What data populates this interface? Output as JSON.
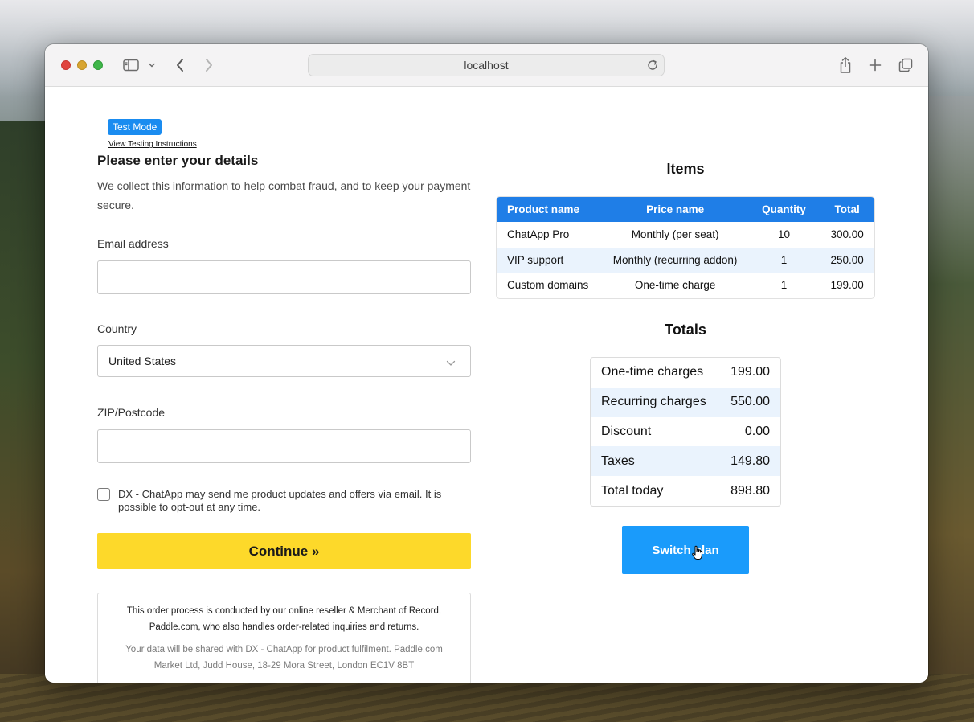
{
  "browser": {
    "address": "localhost"
  },
  "test_mode": {
    "badge": "Test Mode",
    "link": "View Testing Instructions"
  },
  "details": {
    "heading": "Please enter your details",
    "description": "We collect this information to help combat fraud, and to keep your payment secure.",
    "email_label": "Email address",
    "email_value": "",
    "country_label": "Country",
    "country_value": "United States",
    "zip_label": "ZIP/Postcode",
    "zip_value": "",
    "checkbox_label": "DX - ChatApp may send me product updates and offers via email. It is possible to opt-out at any time.",
    "checkbox_checked": false,
    "continue_label": "Continue »",
    "notice_primary": "This order process is conducted by our online reseller & Merchant of Record, Paddle.com, who also handles order-related inquiries and returns.",
    "notice_secondary": "Your data will be shared with DX - ChatApp for product fulfilment. Paddle.com Market Ltd, Judd House, 18-29 Mora Street, London EC1V 8BT"
  },
  "items": {
    "heading": "Items",
    "columns": [
      "Product name",
      "Price name",
      "Quantity",
      "Total"
    ],
    "rows": [
      [
        "ChatApp Pro",
        "Monthly (per seat)",
        "10",
        "300.00"
      ],
      [
        "VIP support",
        "Monthly (recurring addon)",
        "1",
        "250.00"
      ],
      [
        "Custom domains",
        "One-time charge",
        "1",
        "199.00"
      ]
    ]
  },
  "totals": {
    "heading": "Totals",
    "rows": [
      [
        "One-time charges",
        "199.00"
      ],
      [
        "Recurring charges",
        "550.00"
      ],
      [
        "Discount",
        "0.00"
      ],
      [
        "Taxes",
        "149.80"
      ],
      [
        "Total today",
        "898.80"
      ]
    ]
  },
  "actions": {
    "switch_plan": "Switch plan"
  },
  "colors": {
    "accent_blue": "#1a8cf0",
    "table_header": "#1f7ee7",
    "continue_yellow": "#fdd92a",
    "switch_blue": "#1a9bfb"
  }
}
